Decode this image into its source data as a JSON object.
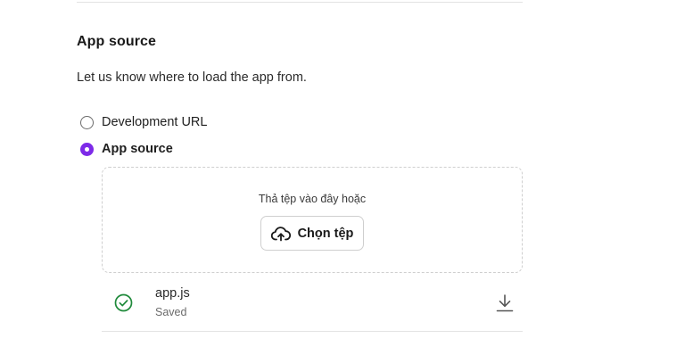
{
  "section": {
    "title": "App source",
    "description": "Let us know where to load the app from."
  },
  "source_options": [
    {
      "label": "Development URL",
      "selected": false
    },
    {
      "label": "App source",
      "selected": true
    }
  ],
  "dropzone": {
    "hint": "Thả tệp vào đây hoặc",
    "button_label": "Chọn tệp",
    "button_icon": "cloud-upload-icon"
  },
  "file": {
    "name": "app.js",
    "status": "Saved",
    "status_icon": "check-circle-icon",
    "action_icon": "download-icon"
  },
  "colors": {
    "accent": "#7d2ae8",
    "success": "#1f8a3b"
  }
}
